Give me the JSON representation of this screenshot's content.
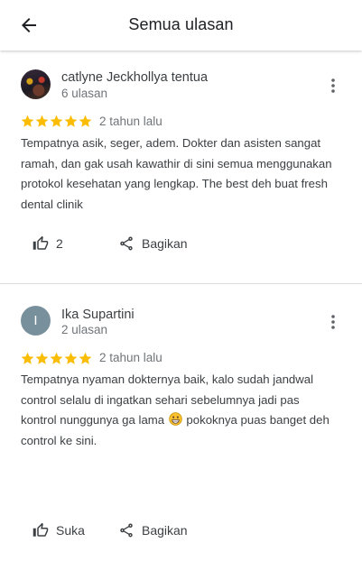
{
  "header": {
    "title": "Semua ulasan",
    "back_icon": "arrow-back-icon"
  },
  "colors": {
    "star": "#fbbc04",
    "avatar_letter_bg": "#78909c",
    "divider": "#dadce0"
  },
  "reviews": [
    {
      "author": "catlyne Jeckhollya tentua",
      "review_count": "6 ulasan",
      "rating": 5,
      "date": "2 tahun lalu",
      "text": "Tempatnya asik, seger, adem. Dokter dan asisten sangat ramah, dan gak usah kawathir di sini semua menggunakan protokol kesehatan yang lengkap. The best deh buat fresh dental clinik",
      "like_label": "2",
      "share_label": "Bagikan"
    },
    {
      "author": "Ika Supartini",
      "avatar_letter": "I",
      "review_count": "2 ulasan",
      "rating": 5,
      "date": "2 tahun lalu",
      "text_before_emoji": "Tempatnya nyaman dokternya baik, kalo sudah jandwal control selalu di ingatkan sehari sebelumnya jadi pas kontrol nunggunya ga lama ",
      "emoji": "grinning-face-icon",
      "text_after_emoji": " pokoknya puas banget deh control ke sini.",
      "like_label": "Suka",
      "share_label": "Bagikan"
    }
  ]
}
